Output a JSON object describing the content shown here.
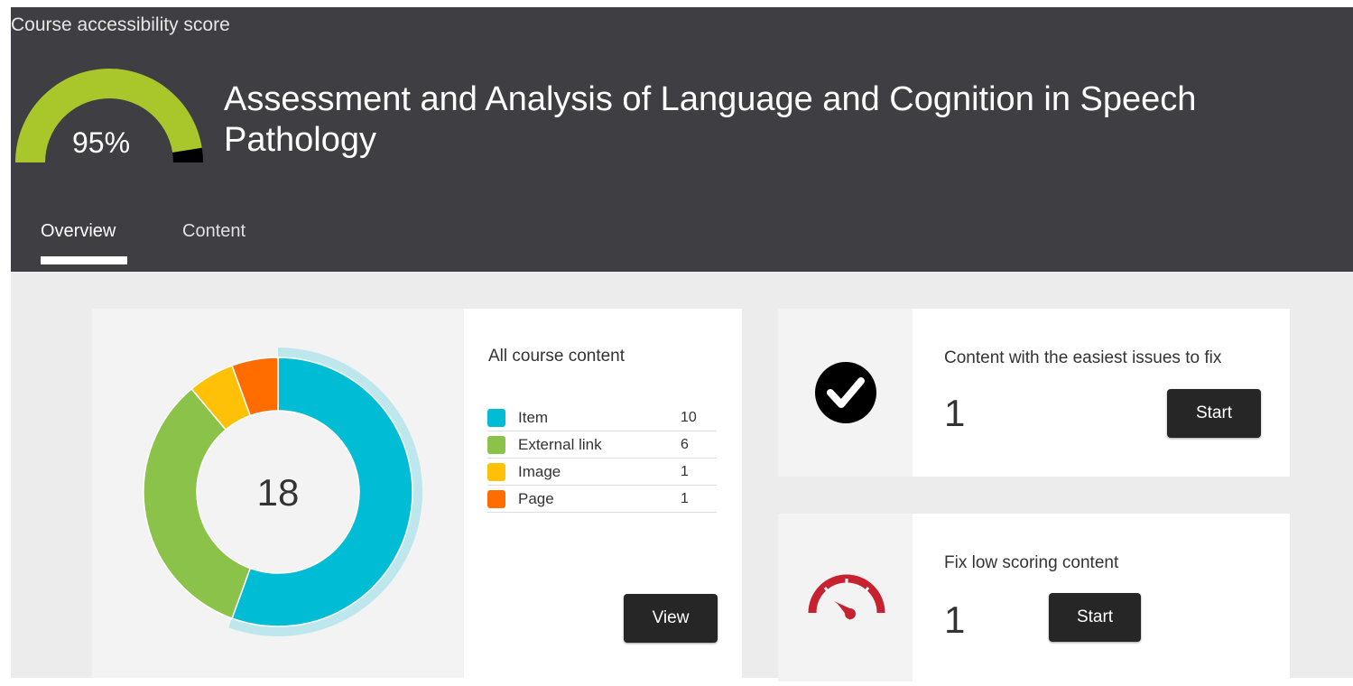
{
  "header": {
    "score_label": "Course accessibility score",
    "score_value": 0.95,
    "score_text": "95%",
    "course_title": "Assessment and Analysis of Language and Cognition in Speech Pathology",
    "tabs": [
      {
        "label": "Overview",
        "active": true
      },
      {
        "label": "Content",
        "active": false
      }
    ]
  },
  "colors": {
    "gauge_fill": "#a9c72a",
    "gauge_rest": "#000000",
    "item": "#00bcd4",
    "external_link": "#8bc34a",
    "image": "#ffc107",
    "page": "#ff6d00",
    "score_alert": "#c6222f"
  },
  "summary": {
    "title": "All course content",
    "total": "18",
    "legend": [
      {
        "label": "Item",
        "count": "10"
      },
      {
        "label": "External link",
        "count": "6"
      },
      {
        "label": "Image",
        "count": "1"
      },
      {
        "label": "Page",
        "count": "1"
      }
    ],
    "view_label": "View"
  },
  "chart_data": {
    "type": "pie",
    "categories": [
      "Item",
      "External link",
      "Image",
      "Page"
    ],
    "values": [
      10,
      6,
      1,
      1
    ],
    "total_label": "18"
  },
  "actions": {
    "easy": {
      "title": "Content with the easiest issues to fix",
      "count": "1",
      "button": "Start",
      "icon": "checkmark-circle-icon"
    },
    "low": {
      "title": "Fix low scoring content",
      "count": "1",
      "button": "Start",
      "icon": "speedometer-icon"
    }
  }
}
